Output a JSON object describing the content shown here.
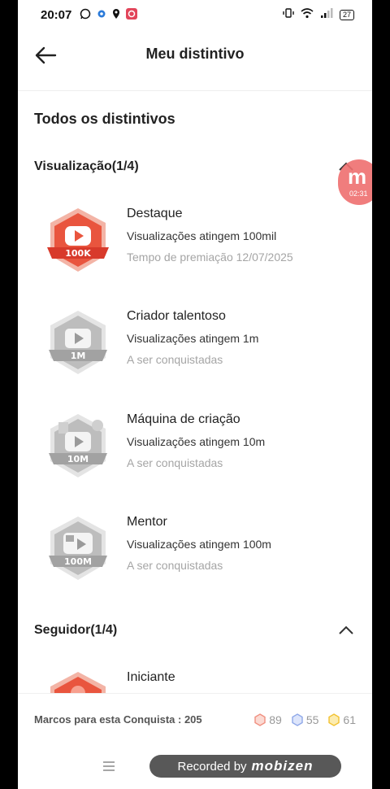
{
  "status_bar": {
    "time": "20:07",
    "battery": "27"
  },
  "header": {
    "title": "Meu distintivo"
  },
  "section_title": "Todos os distintivos",
  "groups": [
    {
      "label": "Visualização(1/4)",
      "badges": [
        {
          "title": "Destaque",
          "desc": "Visualizações atingem 100mil",
          "status": "Tempo de premiação 12/07/2025",
          "badge_text": "100K",
          "earned": true
        },
        {
          "title": "Criador talentoso",
          "desc": "Visualizações atingem 1m",
          "status": "A ser conquistadas",
          "badge_text": "1M",
          "earned": false
        },
        {
          "title": "Máquina de criação",
          "desc": "Visualizações atingem 10m",
          "status": "A ser conquistadas",
          "badge_text": "10M",
          "earned": false
        },
        {
          "title": "Mentor",
          "desc": "Visualizações atingem 100m",
          "status": "A ser conquistadas",
          "badge_text": "100M",
          "earned": false
        }
      ]
    },
    {
      "label": "Seguidor(1/4)",
      "badges": [
        {
          "title": "Iniciante",
          "earned": true
        }
      ]
    }
  ],
  "floating": {
    "letter": "m",
    "time": "02:31"
  },
  "footer": {
    "label": "Marcos para esta Conquista : 205",
    "counts": [
      {
        "icon": "bronze-hex-icon",
        "value": "89",
        "color": "#f08f7f"
      },
      {
        "icon": "silver-hex-icon",
        "value": "55",
        "color": "#8fa8e8"
      },
      {
        "icon": "gold-hex-icon",
        "value": "61",
        "color": "#f2c230"
      }
    ]
  },
  "recorder": {
    "prefix": "Recorded by",
    "brand": "mobizen"
  },
  "colors": {
    "earned_red": "#e74c3c",
    "locked_gray": "#b8b8b8",
    "muted_text": "#a5a5a5"
  }
}
